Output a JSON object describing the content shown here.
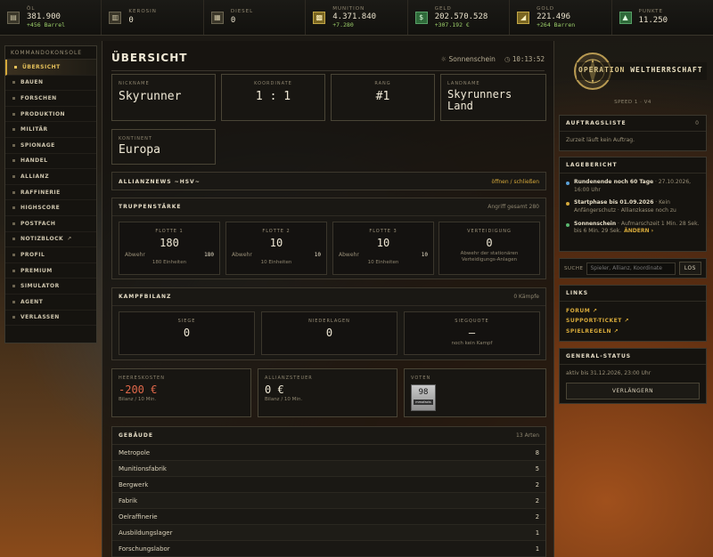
{
  "resources": [
    {
      "name": "ÖL",
      "value": "381.900",
      "delta": "+456 Barrel",
      "icon": "oil-barrel-icon",
      "glyph": "▤",
      "style": ""
    },
    {
      "name": "KEROSIN",
      "value": "0",
      "delta": "",
      "icon": "kerosene-icon",
      "glyph": "▥",
      "style": ""
    },
    {
      "name": "DIESEL",
      "value": "0",
      "delta": "",
      "icon": "diesel-icon",
      "glyph": "▦",
      "style": ""
    },
    {
      "name": "MUNITION",
      "value": "4.371.840",
      "delta": "+7.280",
      "icon": "ammunition-icon",
      "glyph": "▩",
      "style": "gold"
    },
    {
      "name": "GELD",
      "value": "202.570.528",
      "delta": "+307.192 €",
      "icon": "money-icon",
      "glyph": "$",
      "style": "green"
    },
    {
      "name": "GOLD",
      "value": "221.496",
      "delta": "+264 Barren",
      "icon": "gold-icon",
      "glyph": "◢",
      "style": "gold"
    },
    {
      "name": "PUNKTE",
      "value": "11.250",
      "delta": "",
      "icon": "points-icon",
      "glyph": "▲",
      "style": "green"
    }
  ],
  "sidebar": {
    "title": "KOMMANDOKONSOLE",
    "items": [
      {
        "label": "ÜBERSICHT",
        "active": true,
        "ext": false
      },
      {
        "label": "BAUEN",
        "active": false,
        "ext": false
      },
      {
        "label": "FORSCHEN",
        "active": false,
        "ext": false
      },
      {
        "label": "PRODUKTION",
        "active": false,
        "ext": false
      },
      {
        "label": "MILITÄR",
        "active": false,
        "ext": false
      },
      {
        "label": "SPIONAGE",
        "active": false,
        "ext": false
      },
      {
        "label": "HANDEL",
        "active": false,
        "ext": false
      },
      {
        "label": "ALLIANZ",
        "active": false,
        "ext": false
      },
      {
        "label": "RAFFINERIE",
        "active": false,
        "ext": false
      },
      {
        "label": "HIGHSCORE",
        "active": false,
        "ext": false
      },
      {
        "label": "POSTFACH",
        "active": false,
        "ext": false
      },
      {
        "label": "NOTIZBLOCK",
        "active": false,
        "ext": true
      },
      {
        "label": "PROFIL",
        "active": false,
        "ext": false
      },
      {
        "label": "PREMIUM",
        "active": false,
        "ext": false
      },
      {
        "label": "SIMULATOR",
        "active": false,
        "ext": false
      },
      {
        "label": "AGENT",
        "active": false,
        "ext": false
      },
      {
        "label": "VERLASSEN",
        "active": false,
        "ext": false
      }
    ]
  },
  "header": {
    "title": "ÜBERSICHT",
    "weather": "Sonnenschein",
    "time": "10:13:52"
  },
  "info": {
    "nickname_label": "NICKNAME",
    "nickname": "Skyrunner",
    "koordinate_label": "KOORDINATE",
    "koordinate": "1 : 1",
    "rang_label": "RANG",
    "rang": "#1",
    "landname_label": "LANDNAME",
    "landname": "Skyrunners Land",
    "kontinent_label": "KONTINENT",
    "kontinent": "Europa"
  },
  "alliance_news": {
    "title": "ALLIANZNEWS ~HSV~",
    "toggle": "öffnen / schließen"
  },
  "troops": {
    "title": "TRUPPENSTÄRKE",
    "right": "Angriff gesamt 280",
    "fleets": [
      {
        "label": "FLOTTE 1",
        "value": "180",
        "abwehr_label": "Abwehr",
        "abwehr": "180",
        "units": "180 Einheiten"
      },
      {
        "label": "FLOTTE 2",
        "value": "10",
        "abwehr_label": "Abwehr",
        "abwehr": "10",
        "units": "10 Einheiten"
      },
      {
        "label": "FLOTTE 3",
        "value": "10",
        "abwehr_label": "Abwehr",
        "abwehr": "10",
        "units": "10 Einheiten"
      }
    ],
    "defense": {
      "label": "VERTEIDIGUNG",
      "value": "0",
      "desc": "Abwehr der stationären Verteidigungs-Anlagen"
    }
  },
  "battle": {
    "title": "KAMPFBILANZ",
    "right": "0 Kämpfe",
    "siege_label": "SIEGE",
    "siege": "0",
    "niederlagen_label": "NIEDERLAGEN",
    "niederlagen": "0",
    "quote_label": "SIEGQUOTE",
    "quote": "—",
    "quote_sub": "noch kein Kampf"
  },
  "costs": {
    "heer_label": "HEERESKOSTEN",
    "heer": "-200 €",
    "heer_sub": "Bilanz / 10 Min.",
    "steuer_label": "ALLIANZSTEUER",
    "steuer": "0 €",
    "steuer_sub": "Bilanz / 10 Min.",
    "voten_label": "VOTEN",
    "vote_count": "98",
    "vote_badge": "mmofacts"
  },
  "buildings": {
    "title": "GEBÄUDE",
    "right": "13 Arten",
    "rows": [
      {
        "name": "Metropole",
        "count": "8"
      },
      {
        "name": "Munitionsfabrik",
        "count": "5"
      },
      {
        "name": "Bergwerk",
        "count": "2"
      },
      {
        "name": "Fabrik",
        "count": "2"
      },
      {
        "name": "Oelraffinerie",
        "count": "2"
      },
      {
        "name": "Ausbildungslager",
        "count": "1"
      },
      {
        "name": "Forschungslabor",
        "count": "1"
      }
    ]
  },
  "logo": {
    "line1": "OPERATION",
    "line2": "WELTHERRSCHAFT",
    "speed": "SPEED 1 · V4"
  },
  "auftrag": {
    "title": "AUFTRAGSLISTE",
    "count": "0",
    "text": "Zurzeit läuft kein Auftrag."
  },
  "lage": {
    "title": "LAGEBERICHT",
    "items": [
      {
        "bold": "Rundenende noch 60 Tage",
        "rest": " · 27.10.2026, 16:00 Uhr",
        "color": "#5aa0d8",
        "link": ""
      },
      {
        "bold": "Startphase bis 01.09.2026",
        "rest": " · Kein Anfängerschutz · Allianzkasse noch zu",
        "color": "#d6a93a",
        "link": ""
      },
      {
        "bold": "Sonnenschein",
        "rest": " · Aufmarschzeit 1 Min. 28 Sek. bis 6 Min. 29 Sek.",
        "color": "#5ab870",
        "link": "ÄNDERN ›"
      }
    ]
  },
  "search": {
    "label": "SUCHE",
    "placeholder": "Spieler, Allianz, Koordinate",
    "button": "LOS"
  },
  "links": {
    "title": "LINKS",
    "items": [
      "FORUM ↗",
      "SUPPORT-TICKET ↗",
      "SPIELREGELN ↗"
    ]
  },
  "general": {
    "title": "GENERAL-STATUS",
    "text": "aktiv bis 31.12.2026, 23:00 Uhr",
    "button": "VERLÄNGERN"
  }
}
